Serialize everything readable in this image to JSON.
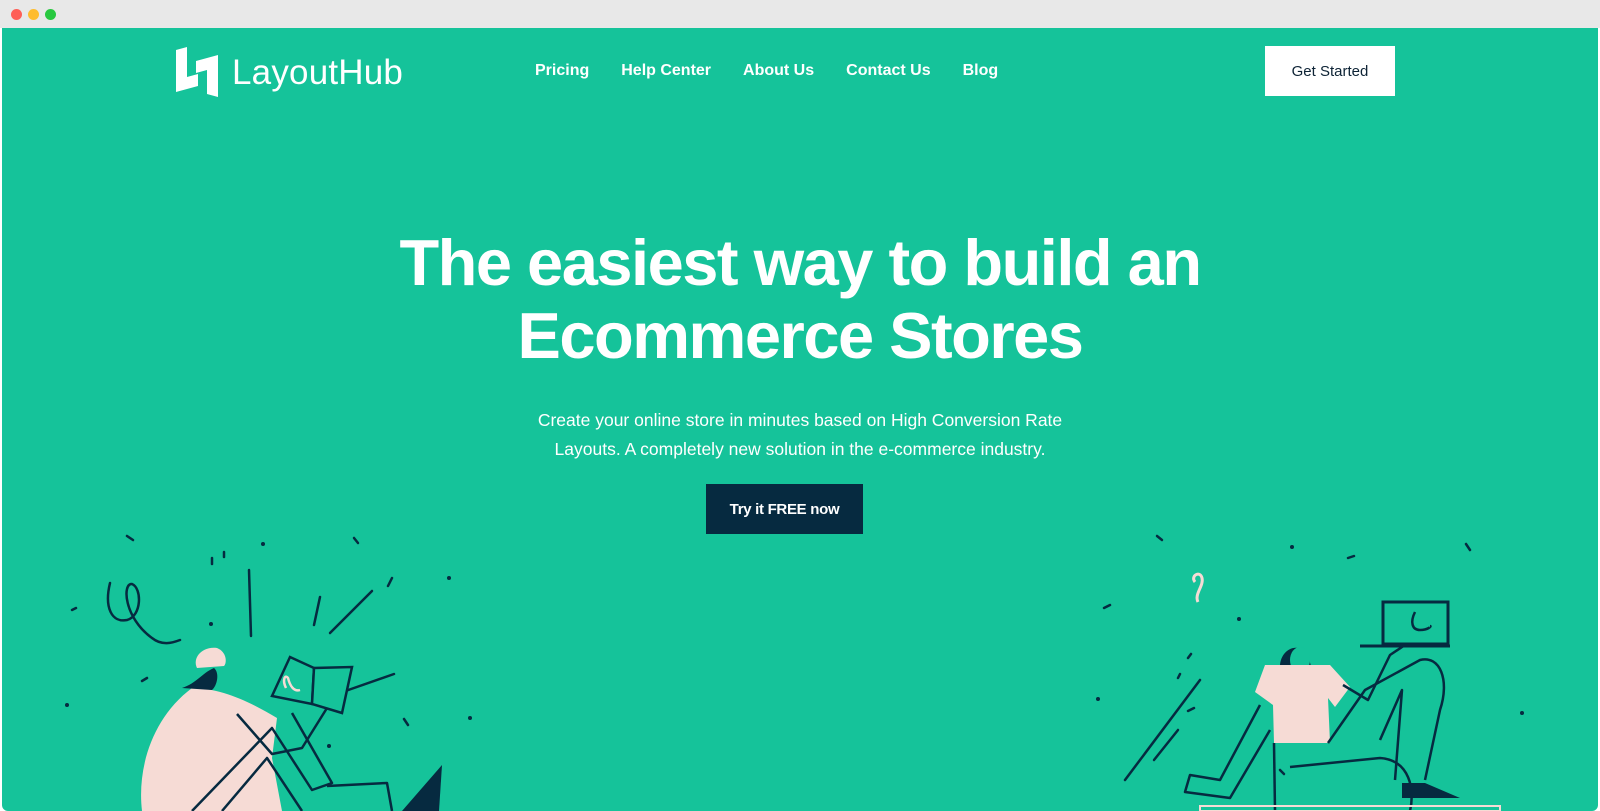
{
  "window": {
    "controls": [
      "close",
      "minimize",
      "maximize"
    ]
  },
  "brand": {
    "name": "LayoutHub",
    "logo_icon": "layouthub-logo-icon",
    "background": "#15c39a",
    "dark": "#062a40",
    "skin": "#f6dbd5"
  },
  "nav": {
    "items": [
      {
        "label": "Pricing"
      },
      {
        "label": "Help Center"
      },
      {
        "label": "About Us"
      },
      {
        "label": "Contact Us"
      },
      {
        "label": "Blog"
      }
    ],
    "cta_label": "Get Started"
  },
  "hero": {
    "title_line1": "The easiest way to build an",
    "title_line2": "Ecommerce Stores",
    "subtitle_line1": "Create your online store in minutes based on High Conversion Rate",
    "subtitle_line2": "Layouts. A completely new solution in the e-commerce industry.",
    "cta_label": "Try it FREE now"
  },
  "illustrations": {
    "left": "person-reading-book-illustration",
    "right": "person-holding-laptop-illustration"
  }
}
